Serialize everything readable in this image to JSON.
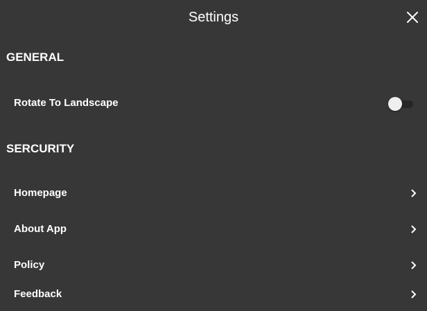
{
  "header": {
    "title": "Settings",
    "close_icon": "close-icon"
  },
  "sections": {
    "general": {
      "title": "GENERAL",
      "rotate": {
        "label": "Rotate To Landscape",
        "enabled": false
      }
    },
    "security": {
      "title": "SERCURITY",
      "items": [
        {
          "label": "Homepage",
          "icon": "chevron-right-icon"
        },
        {
          "label": "About App",
          "icon": "chevron-right-icon"
        },
        {
          "label": "Policy",
          "icon": "chevron-right-icon"
        },
        {
          "label": "Feedback",
          "icon": "chevron-right-icon"
        }
      ]
    }
  },
  "colors": {
    "background": "#373737",
    "text": "#ffffff",
    "toggle_knob": "#efefef",
    "toggle_track": "#262626"
  }
}
